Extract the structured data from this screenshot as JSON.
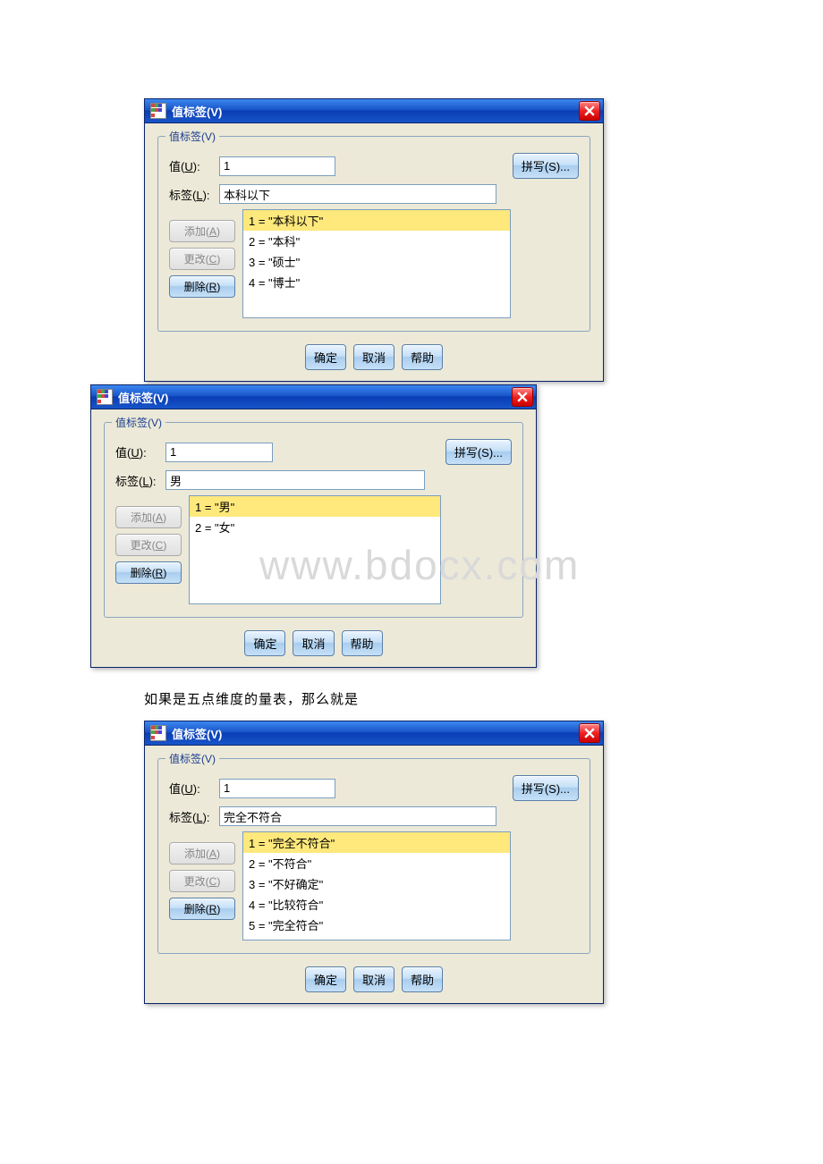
{
  "watermark": "www.bdocx.com",
  "between_text": "如果是五点维度的量表，那么就是",
  "common": {
    "title": "值标签(V)",
    "group_label": "值标签(V)",
    "label_value_prefix": "值(",
    "label_value_ul": "U",
    "label_value_suffix": "):",
    "label_label_prefix": "标签(",
    "label_label_ul": "L",
    "label_label_suffix": "):",
    "spell_btn": "拼写(S)...",
    "add_btn_pre": "添加(",
    "add_btn_ul": "A",
    "add_btn_post": ")",
    "change_btn_pre": "更改(",
    "change_btn_ul": "C",
    "change_btn_post": ")",
    "remove_btn_pre": "删除(",
    "remove_btn_ul": "R",
    "remove_btn_post": ")",
    "ok_btn": "确定",
    "cancel_btn": "取消",
    "help_btn": "帮助"
  },
  "dialog1": {
    "value": "1",
    "label": "本科以下",
    "items": {
      "0": "1 = \"本科以下\"",
      "1": "2 = \"本科\"",
      "2": "3 = \"硕士\"",
      "3": "4 = \"博士\""
    }
  },
  "dialog2": {
    "value": "1",
    "label": "男",
    "items": {
      "0": "1 = \"男\"",
      "1": "2 = \"女\""
    }
  },
  "dialog3": {
    "value": "1",
    "label": "完全不符合",
    "items": {
      "0": "1 = \"完全不符合\"",
      "1": "2 = \"不符合\"",
      "2": "3 = \"不好确定\"",
      "3": "4 = \"比较符合\"",
      "4": "5 = \"完全符合\""
    }
  }
}
